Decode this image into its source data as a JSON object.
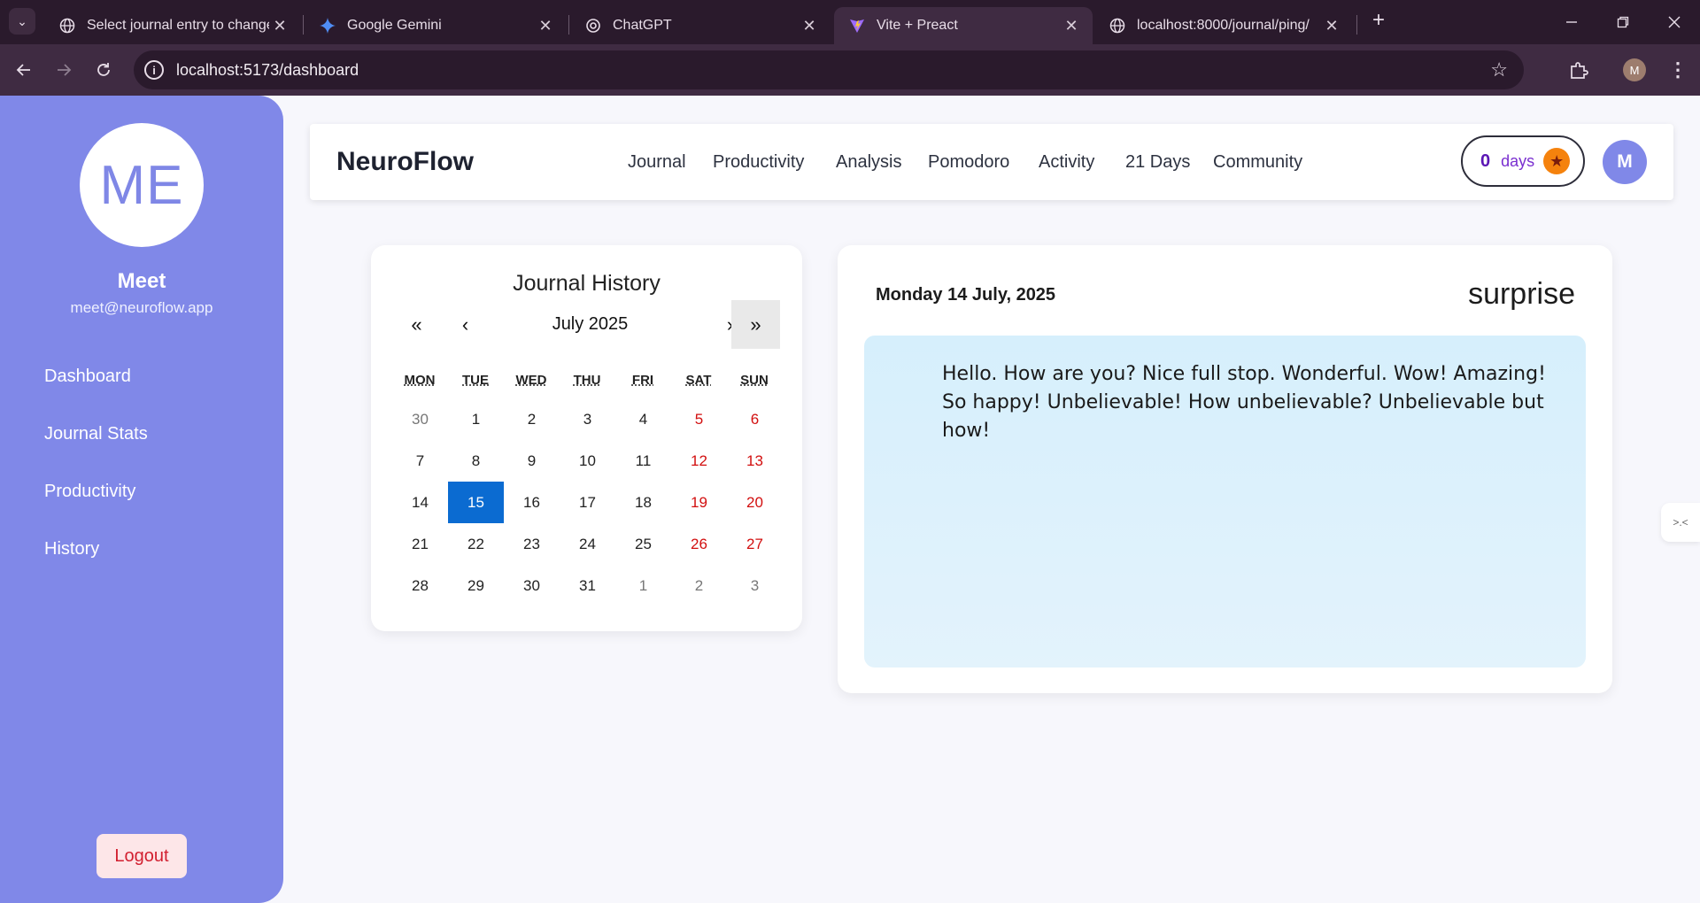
{
  "browser": {
    "tabs": [
      {
        "title": "Select journal entry to change |",
        "icon": "globe-icon"
      },
      {
        "title": "Google Gemini",
        "icon": "gemini-icon"
      },
      {
        "title": "ChatGPT",
        "icon": "chatgpt-icon"
      },
      {
        "title": "Vite + Preact",
        "icon": "vite-icon"
      },
      {
        "title": "localhost:8000/journal/ping/",
        "icon": "globe-icon"
      }
    ],
    "url": "localhost:5173/dashboard",
    "profile_initial": "M"
  },
  "sidebar": {
    "avatar_initials": "ME",
    "name": "Meet",
    "email": "meet@neuroflow.app",
    "links": [
      "Dashboard",
      "Journal Stats",
      "Productivity",
      "History"
    ],
    "logout_label": "Logout"
  },
  "topnav": {
    "brand": "NeuroFlow",
    "links": [
      "Journal",
      "Productivity",
      "Analysis",
      "Pomodoro",
      "Activity",
      "21 Days",
      "Community"
    ],
    "streak_count": "0",
    "streak_unit": "days",
    "avatar_initial": "M"
  },
  "calendar": {
    "title": "Journal History",
    "month_label": "July 2025",
    "nav": {
      "prev_year": "«",
      "prev_month": "‹",
      "next_month": "›",
      "next_year": "»"
    },
    "weekdays": [
      "MON",
      "TUE",
      "WED",
      "THU",
      "FRI",
      "SAT",
      "SUN"
    ],
    "weeks": [
      [
        "30",
        "1",
        "2",
        "3",
        "4",
        "5",
        "6"
      ],
      [
        "7",
        "8",
        "9",
        "10",
        "11",
        "12",
        "13"
      ],
      [
        "14",
        "15",
        "16",
        "17",
        "18",
        "19",
        "20"
      ],
      [
        "21",
        "22",
        "23",
        "24",
        "25",
        "26",
        "27"
      ],
      [
        "28",
        "29",
        "30",
        "31",
        "1",
        "2",
        "3"
      ]
    ],
    "selected_day": "15",
    "colors": {
      "selected": "#0b6bd1",
      "weekend": "#d20f0f"
    }
  },
  "entry": {
    "date": "Monday 14 July, 2025",
    "mood": "surprise",
    "text": "Hello. How are you? Nice full stop. Wonderful. Wow! Amazing! So happy! Unbelievable! How unbelievable? Unbelievable but how!"
  },
  "side_widget": {
    "label": ">.<"
  }
}
